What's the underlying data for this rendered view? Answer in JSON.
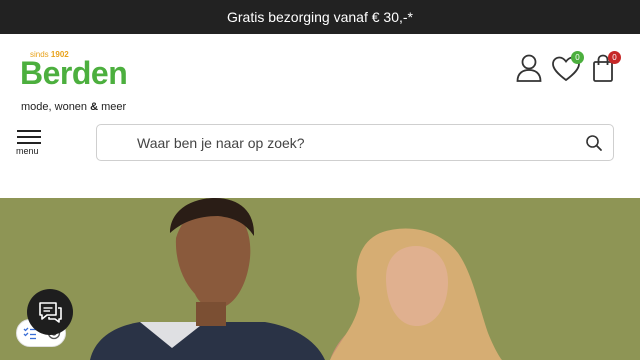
{
  "topbar": {
    "text": "Gratis bezorging vanaf € 30,-*"
  },
  "logo": {
    "since_prefix": "sinds",
    "since_year": "1902",
    "brand": "Berden",
    "tagline_prefix": "mode, wonen",
    "tagline_amp": "&",
    "tagline_suffix": "meer"
  },
  "header": {
    "wishlist_count": "0",
    "cart_count": "0",
    "menu_label": "menu"
  },
  "search": {
    "placeholder": "Waar ben je naar op zoek?"
  },
  "colors": {
    "brand_green": "#4caf3e",
    "accent_orange": "#e8a21b",
    "badge_green": "#4caf3e",
    "badge_red": "#c62828",
    "topbar_bg": "#222222",
    "hero_bg": "#8a9152"
  },
  "icons": [
    "account-icon",
    "heart-icon",
    "shopping-bag-icon",
    "hamburger-icon",
    "search-icon",
    "chat-icon",
    "checklist-icon",
    "settings-icon"
  ]
}
